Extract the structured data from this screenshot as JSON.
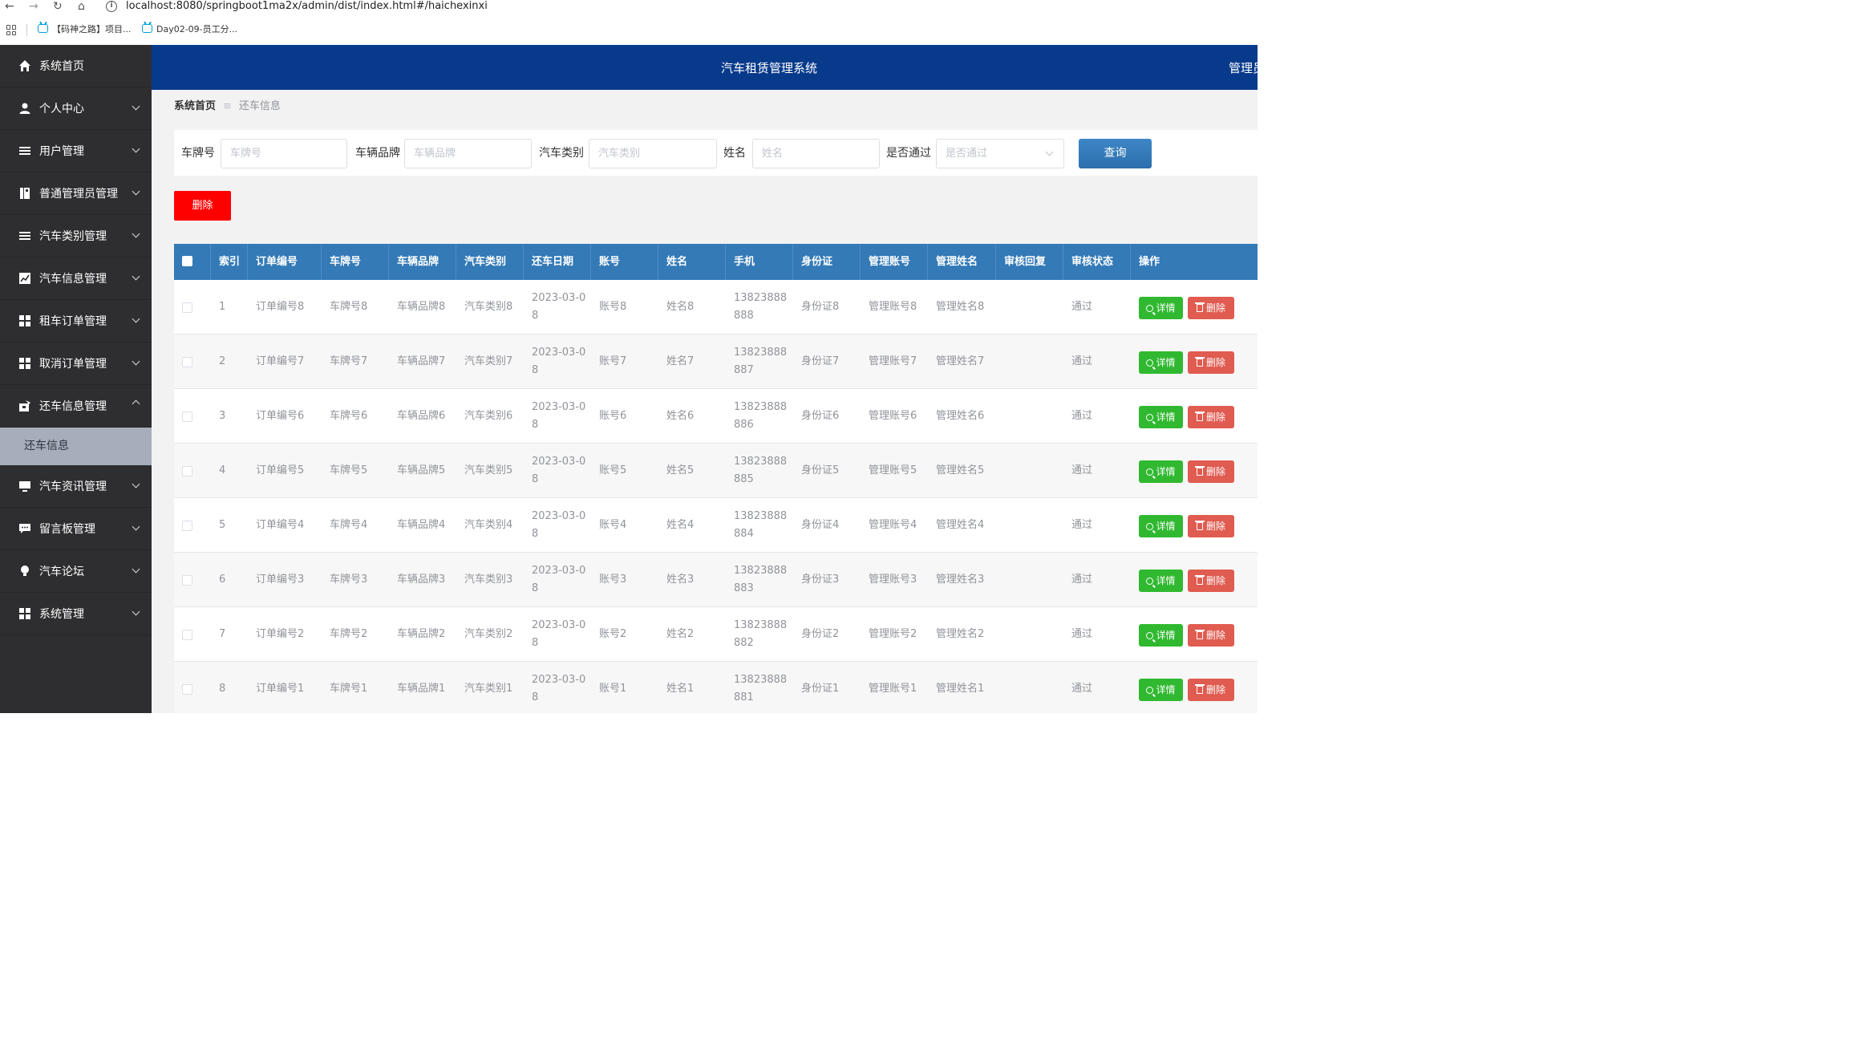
{
  "browser": {
    "url": "localhost:8080/springboot1ma2x/admin/dist/index.html#/haichexinxi",
    "bookmarks": [
      {
        "label": "【码神之路】项目..."
      },
      {
        "label": "Day02-09-员工分..."
      }
    ]
  },
  "header": {
    "title": "汽车租赁管理系统",
    "user": "管理员 admin"
  },
  "sidebar": {
    "items": [
      {
        "label": "系统首页",
        "icon": "home-icon"
      },
      {
        "label": "个人中心",
        "icon": "user-icon"
      },
      {
        "label": "用户管理",
        "icon": "menu-icon"
      },
      {
        "label": "普通管理员管理",
        "icon": "document-icon"
      },
      {
        "label": "汽车类别管理",
        "icon": "list-icon"
      },
      {
        "label": "汽车信息管理",
        "icon": "chart-icon"
      },
      {
        "label": "租车订单管理",
        "icon": "grid-icon"
      },
      {
        "label": "取消订单管理",
        "icon": "grid-icon"
      },
      {
        "label": "还车信息管理",
        "icon": "car-return-icon"
      },
      {
        "label": "汽车资讯管理",
        "icon": "monitor-icon"
      },
      {
        "label": "留言板管理",
        "icon": "message-icon"
      },
      {
        "label": "汽车论坛",
        "icon": "bulb-icon"
      },
      {
        "label": "系统管理",
        "icon": "grid-icon"
      }
    ],
    "active_sub": "还车信息"
  },
  "breadcrumb": {
    "home": "系统首页",
    "separator": "≡",
    "current": "还车信息"
  },
  "search": {
    "plate": {
      "label": "车牌号",
      "placeholder": "车牌号"
    },
    "brand": {
      "label": "车辆品牌",
      "placeholder": "车辆品牌"
    },
    "category": {
      "label": "汽车类别",
      "placeholder": "汽车类别"
    },
    "name": {
      "label": "姓名",
      "placeholder": "姓名"
    },
    "passed": {
      "label": "是否通过",
      "placeholder": "是否通过"
    },
    "query_label": "查询"
  },
  "actions": {
    "batch_delete": "删除"
  },
  "table": {
    "columns": [
      "索引",
      "订单编号",
      "车牌号",
      "车辆品牌",
      "汽车类别",
      "还车日期",
      "账号",
      "姓名",
      "手机",
      "身份证",
      "管理账号",
      "管理姓名",
      "审核回复",
      "审核状态",
      "操作"
    ],
    "detail_label": "详情",
    "delete_label": "删除",
    "rows": [
      {
        "index": "1",
        "order": "订单编号8",
        "plate": "车牌号8",
        "brand": "车辆品牌8",
        "category": "汽车类别8",
        "date": "2023-03-08",
        "account": "账号8",
        "name": "姓名8",
        "phone": "13823888888",
        "id_card": "身份证8",
        "admin_account": "管理账号8",
        "admin_name": "管理姓名8",
        "reply": "",
        "status": "通过"
      },
      {
        "index": "2",
        "order": "订单编号7",
        "plate": "车牌号7",
        "brand": "车辆品牌7",
        "category": "汽车类别7",
        "date": "2023-03-08",
        "account": "账号7",
        "name": "姓名7",
        "phone": "13823888887",
        "id_card": "身份证7",
        "admin_account": "管理账号7",
        "admin_name": "管理姓名7",
        "reply": "",
        "status": "通过"
      },
      {
        "index": "3",
        "order": "订单编号6",
        "plate": "车牌号6",
        "brand": "车辆品牌6",
        "category": "汽车类别6",
        "date": "2023-03-08",
        "account": "账号6",
        "name": "姓名6",
        "phone": "13823888886",
        "id_card": "身份证6",
        "admin_account": "管理账号6",
        "admin_name": "管理姓名6",
        "reply": "",
        "status": "通过"
      },
      {
        "index": "4",
        "order": "订单编号5",
        "plate": "车牌号5",
        "brand": "车辆品牌5",
        "category": "汽车类别5",
        "date": "2023-03-08",
        "account": "账号5",
        "name": "姓名5",
        "phone": "13823888885",
        "id_card": "身份证5",
        "admin_account": "管理账号5",
        "admin_name": "管理姓名5",
        "reply": "",
        "status": "通过"
      },
      {
        "index": "5",
        "order": "订单编号4",
        "plate": "车牌号4",
        "brand": "车辆品牌4",
        "category": "汽车类别4",
        "date": "2023-03-08",
        "account": "账号4",
        "name": "姓名4",
        "phone": "13823888884",
        "id_card": "身份证4",
        "admin_account": "管理账号4",
        "admin_name": "管理姓名4",
        "reply": "",
        "status": "通过"
      },
      {
        "index": "6",
        "order": "订单编号3",
        "plate": "车牌号3",
        "brand": "车辆品牌3",
        "category": "汽车类别3",
        "date": "2023-03-08",
        "account": "账号3",
        "name": "姓名3",
        "phone": "13823888883",
        "id_card": "身份证3",
        "admin_account": "管理账号3",
        "admin_name": "管理姓名3",
        "reply": "",
        "status": "通过"
      },
      {
        "index": "7",
        "order": "订单编号2",
        "plate": "车牌号2",
        "brand": "车辆品牌2",
        "category": "汽车类别2",
        "date": "2023-03-08",
        "account": "账号2",
        "name": "姓名2",
        "phone": "13823888882",
        "id_card": "身份证2",
        "admin_account": "管理账号2",
        "admin_name": "管理姓名2",
        "reply": "",
        "status": "通过"
      },
      {
        "index": "8",
        "order": "订单编号1",
        "plate": "车牌号1",
        "brand": "车辆品牌1",
        "category": "汽车类别1",
        "date": "2023-03-08",
        "account": "账号1",
        "name": "姓名1",
        "phone": "13823888881",
        "id_card": "身份证1",
        "admin_account": "管理账号1",
        "admin_name": "管理姓名1",
        "reply": "",
        "status": "通过"
      }
    ]
  },
  "colors": {
    "sidebar_bg": "#2e2e30",
    "header_bg": "#083a8b",
    "table_head_bg": "#337ab7",
    "active_sub_bg": "#a6aebb",
    "danger": "#ff0000",
    "success": "#30b930"
  }
}
